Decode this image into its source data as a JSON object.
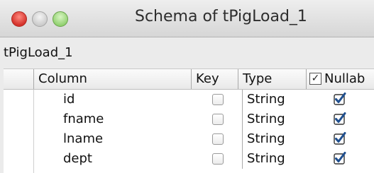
{
  "window": {
    "title": "Schema of tPigLoad_1"
  },
  "component_name": "tPigLoad_1",
  "columns": {
    "column": "Column",
    "key": "Key",
    "type": "Type",
    "nullable": "Nullab"
  },
  "rows": [
    {
      "name": "id",
      "key": false,
      "type": "String",
      "nullable": true
    },
    {
      "name": "fname",
      "key": false,
      "type": "String",
      "nullable": true
    },
    {
      "name": "lname",
      "key": false,
      "type": "String",
      "nullable": true
    },
    {
      "name": "dept",
      "key": false,
      "type": "String",
      "nullable": true
    }
  ],
  "header_nullable_checked": true,
  "colors": {
    "checkmark": "#1f4f8f",
    "close": "#d4312a",
    "zoom": "#8fcf6e"
  }
}
